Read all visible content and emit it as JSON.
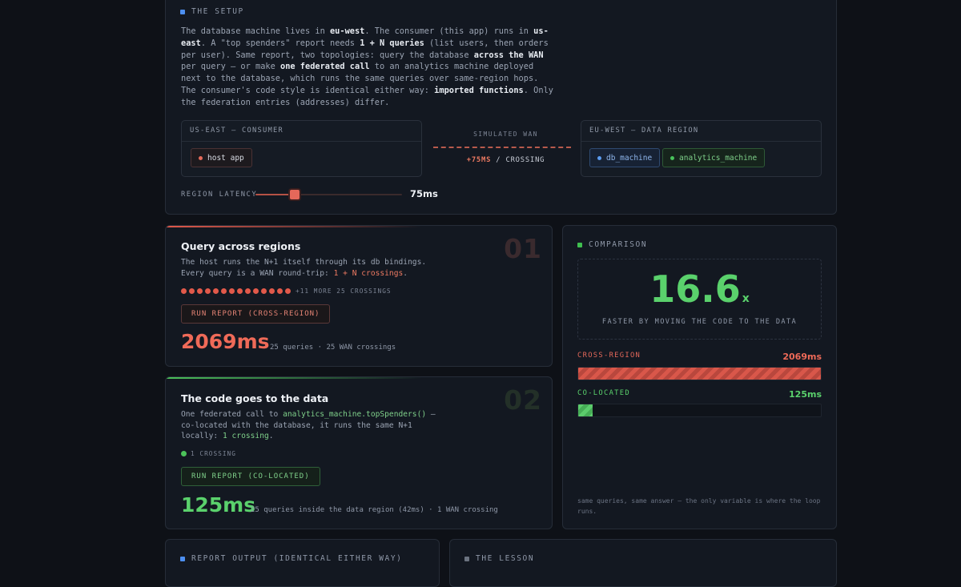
{
  "setup": {
    "header": "THE SETUP",
    "intro": {
      "p1": "The database machine lives in ",
      "b1": "eu-west",
      "p2": ". The consumer (this app) runs in ",
      "b2": "us-east",
      "p3": ". A \"top spenders\" report needs ",
      "b3": "1 + N queries",
      "p4": " (list users, then orders per user). Same report, two topologies: query the database ",
      "b4": "across the WAN",
      "p5": " per query — or make ",
      "b5": "one federated call",
      "p6": " to an analytics machine deployed next to the database, which runs the same queries over same-region hops. The consumer's code style is identical either way: ",
      "b6": "imported functions",
      "p7": ". Only the federation entries (addresses) differ."
    },
    "consumer_region": {
      "title": "US-EAST — CONSUMER",
      "chip": "host app"
    },
    "wan": {
      "label": "SIMULATED WAN",
      "cost": "+75MS",
      "suffix": " / CROSSING"
    },
    "data_region": {
      "title": "EU-WEST — DATA REGION",
      "chips": [
        "db_machine",
        "analytics_machine"
      ]
    },
    "latency": {
      "label": "REGION LATENCY",
      "value": "75ms",
      "fraction": 0.27
    }
  },
  "cross_region": {
    "title": "Query across regions",
    "number": "01",
    "desc_a": "The host runs the N+1 itself through its db bindings. Every query is a WAN round-trip: ",
    "desc_hl": "1 + N crossings",
    "desc_b": ".",
    "dots_shown": 14,
    "more": "+11 MORE 25 CROSSINGS",
    "button": "RUN REPORT (CROSS-REGION)",
    "result": "2069ms",
    "note": "25 queries · 25 WAN crossings"
  },
  "co_located": {
    "title": "The code goes to the data",
    "number": "02",
    "desc_a": "One federated call to ",
    "desc_hl": "analytics_machine.topSpenders()",
    "desc_b": " — co-located with the database, it runs the same N+1 locally: ",
    "desc_hl2": "1 crossing",
    "desc_c": ".",
    "crossing_label": "1 CROSSING",
    "button": "RUN REPORT (CO-LOCATED)",
    "result": "125ms",
    "note": "25 queries inside the data region (42ms) · 1 WAN crossing"
  },
  "comparison": {
    "header": "COMPARISON",
    "factor": "16.6",
    "factor_unit": "x",
    "subtitle": "FASTER BY MOVING THE CODE TO THE DATA",
    "cross_label": "CROSS-REGION",
    "cross_value": "2069ms",
    "cross_fraction": 1.0,
    "co_label": "CO-LOCATED",
    "co_value": "125ms",
    "co_fraction": 0.06,
    "footnote": "same queries, same answer — the only variable is where the loop runs."
  },
  "report_output": {
    "header": "REPORT OUTPUT (IDENTICAL EITHER WAY)"
  },
  "lesson": {
    "header": "THE LESSON"
  },
  "colors": {
    "red": "#ef6a58",
    "green": "#5ad16c",
    "blue": "#4d8ff0"
  }
}
